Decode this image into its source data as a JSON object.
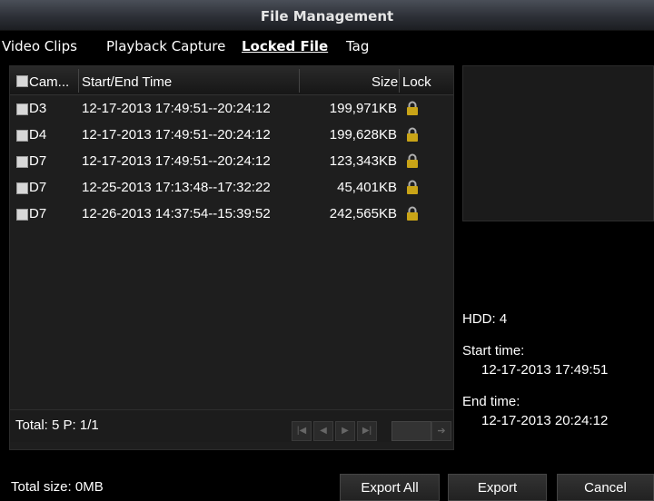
{
  "window": {
    "title": "File Management"
  },
  "tabs": [
    {
      "label": "Video Clips"
    },
    {
      "label": "Playback Capture"
    },
    {
      "label": "Locked File"
    },
    {
      "label": "Tag"
    }
  ],
  "table": {
    "headers": {
      "camera": "Cam...",
      "time": "Start/End Time",
      "size": "Size",
      "lock": "Lock"
    },
    "rows": [
      {
        "camera": "D3",
        "time": "12-17-2013 17:49:51--20:24:12",
        "size": "199,971KB"
      },
      {
        "camera": "D4",
        "time": "12-17-2013 17:49:51--20:24:12",
        "size": "199,628KB"
      },
      {
        "camera": "D7",
        "time": "12-17-2013 17:49:51--20:24:12",
        "size": "123,343KB"
      },
      {
        "camera": "D7",
        "time": "12-25-2013 17:13:48--17:32:22",
        "size": "45,401KB"
      },
      {
        "camera": "D7",
        "time": "12-26-2013 14:37:54--15:39:52",
        "size": "242,565KB"
      }
    ],
    "footer": "Total: 5  P: 1/1"
  },
  "info": {
    "hdd": "HDD: 4",
    "start_label": "Start time:",
    "start_value": "12-17-2013 17:49:51",
    "end_label": "End time:",
    "end_value": "12-17-2013 20:24:12"
  },
  "bottom": {
    "total_size": "Total size: 0MB",
    "export_all": "Export All",
    "export": "Export",
    "cancel": "Cancel"
  },
  "colors": {
    "lock_gold": "#c9a417",
    "title_bar": "#2d3037",
    "panel": "#1e1e1e"
  }
}
